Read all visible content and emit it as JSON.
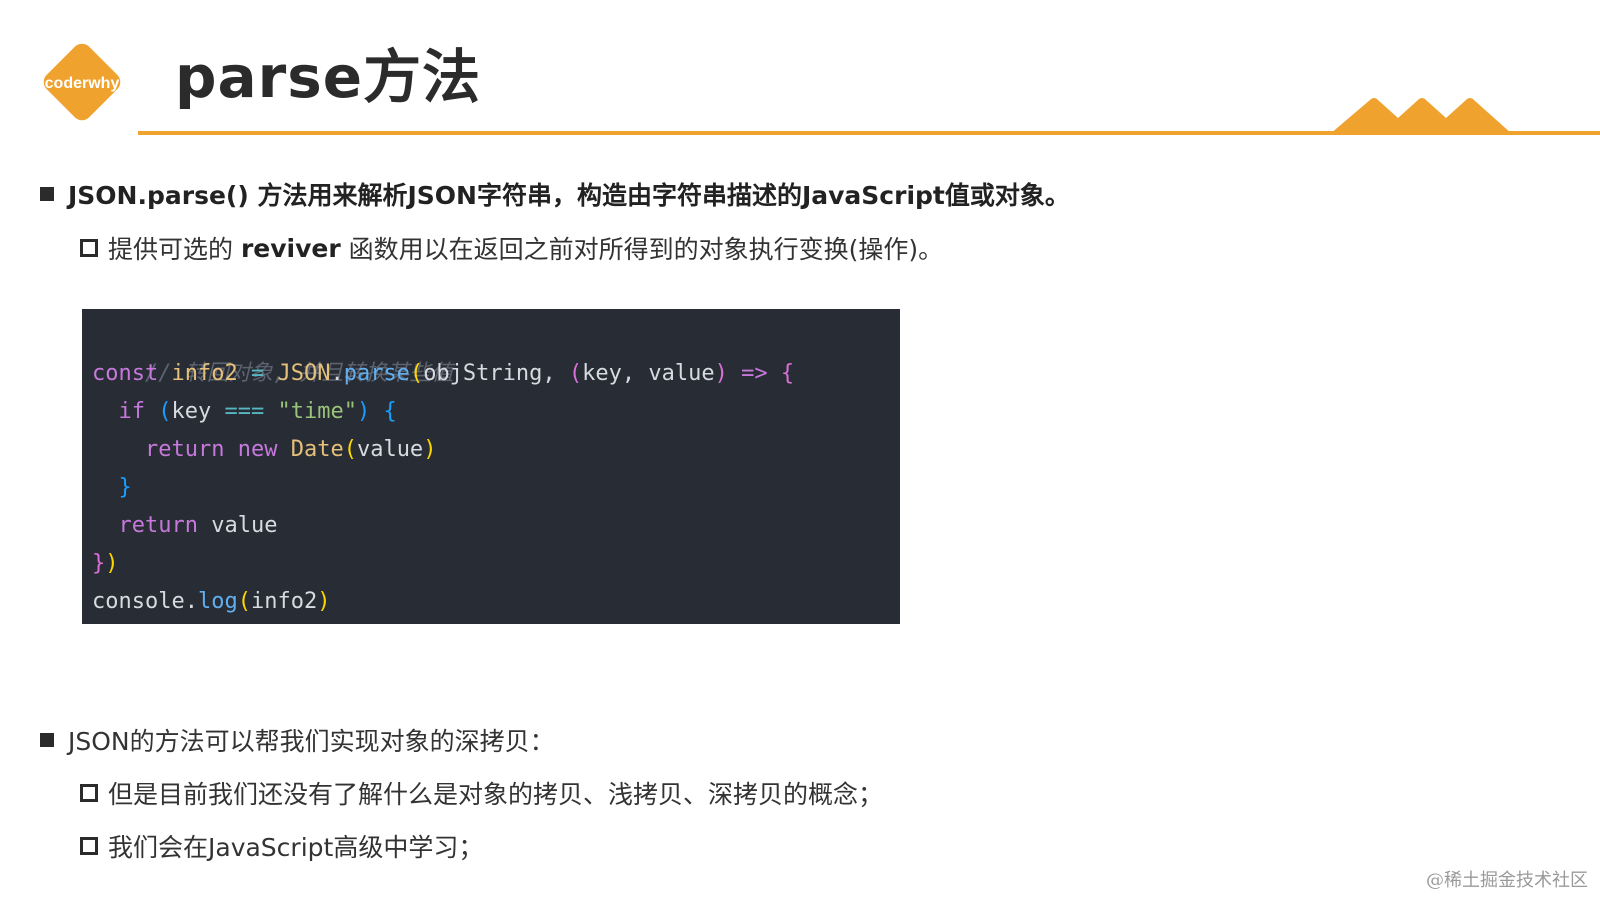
{
  "logo": {
    "text": "coderwhy",
    "color": "#f0a22e"
  },
  "header": {
    "title": "parse方法",
    "accent_color": "#f0a22e"
  },
  "bullets": {
    "b1": {
      "text": "JSON.parse() 方法用来解析JSON字符串，构造由字符串描述的JavaScript值或对象。"
    },
    "b1_sub": {
      "prefix": "提供可选的 ",
      "keyword": "reviver",
      "suffix": " 函数用以在返回之前对所得到的对象执行变换(操作)。"
    },
    "b2": {
      "text": "JSON的方法可以帮我们实现对象的深拷贝："
    },
    "b2_sub1": {
      "text": "但是目前我们还没有了解什么是对象的拷贝、浅拷贝、深拷贝的概念；"
    },
    "b2_sub2": {
      "text": "我们会在JavaScript高级中学习；"
    }
  },
  "code": {
    "comment": "// 转回对象, 并且转换某些值",
    "l1": {
      "const": "const",
      "name": "info2",
      "eq": " = ",
      "obj": "JSON",
      "dot": ".",
      "fn": "parse",
      "open": "(",
      "args": "objString, ",
      "p2open": "(",
      "params": "key, value",
      "p2close": ")",
      "arrow": " => ",
      "brace": "{"
    },
    "l2": {
      "indent": "  ",
      "kw": "if",
      "sp": " ",
      "open": "(",
      "var": "key",
      "op": " === ",
      "str": "\"time\"",
      "close": ")",
      "sp2": " ",
      "brace": "{"
    },
    "l3": {
      "indent": "    ",
      "kw1": "return",
      "sp": " ",
      "kw2": "new",
      "sp2": " ",
      "cls": "Date",
      "open": "(",
      "arg": "value",
      "close": ")"
    },
    "l4": {
      "indent": "  ",
      "brace": "}"
    },
    "l5": {
      "indent": "  ",
      "kw": "return",
      "sp": " ",
      "val": "value"
    },
    "l6": {
      "brace": "}",
      "paren": ")"
    },
    "l7": {
      "obj": "console",
      "dot": ".",
      "fn": "log",
      "open": "(",
      "arg": "info2",
      "close": ")"
    }
  },
  "watermark": "@稀土掘金技术社区"
}
